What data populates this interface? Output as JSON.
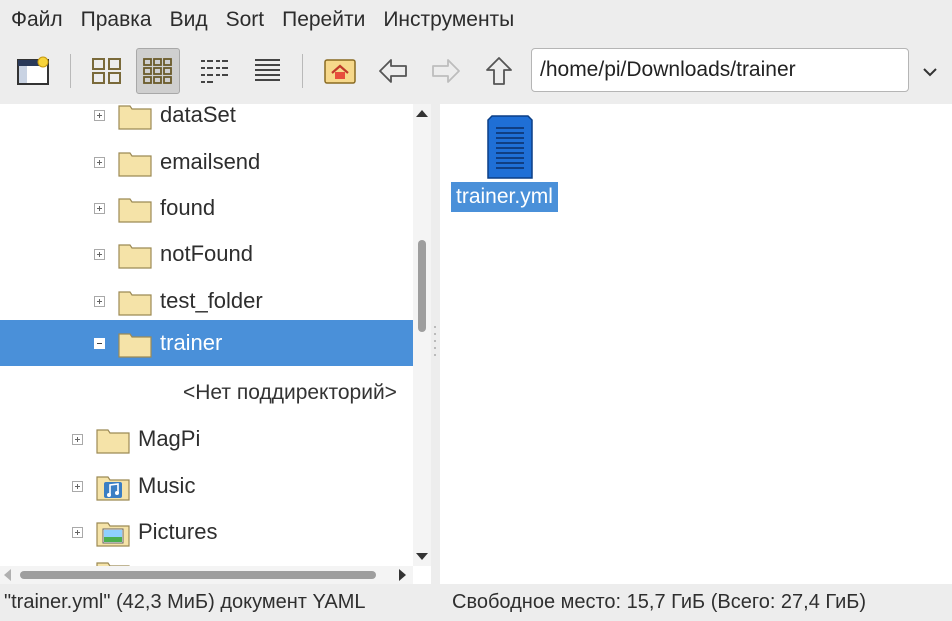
{
  "menu": [
    "Файл",
    "Правка",
    "Вид",
    "Sort",
    "Перейти",
    "Инструменты"
  ],
  "toolbar": {
    "path": "/home/pi/Downloads/trainer",
    "buttons": [
      "new-window",
      "icon-view",
      "thumbnail-view",
      "compact-view",
      "detailed-list-view",
      "home",
      "back",
      "forward",
      "up"
    ]
  },
  "tree": {
    "items": [
      {
        "label": "dataSet",
        "expander": "plus"
      },
      {
        "label": "emailsend",
        "expander": "plus"
      },
      {
        "label": "found",
        "expander": "plus"
      },
      {
        "label": "notFound",
        "expander": "plus"
      },
      {
        "label": "test_folder",
        "expander": "plus"
      },
      {
        "label": "trainer",
        "expander": "minus",
        "selected": true
      },
      {
        "label": "<Нет поддиректорий>"
      },
      {
        "label": "MagPi",
        "expander": "plus"
      },
      {
        "label": "Music",
        "expander": "plus",
        "icon": "music-folder-icon"
      },
      {
        "label": "Pictures",
        "expander": "plus",
        "icon": "pictures-folder-icon"
      }
    ]
  },
  "files": [
    {
      "name": "trainer.yml",
      "icon": "text-document-icon",
      "selected": true
    }
  ],
  "status": {
    "left": "\"trainer.yml\" (42,3 МиБ) документ YAML",
    "right": "Свободное место: 15,7 ГиБ (Всего: 27,4 ГиБ)"
  },
  "colors": {
    "selection": "#4a90d9",
    "chrome": "#ededed",
    "folder": "#f5e3a8"
  }
}
